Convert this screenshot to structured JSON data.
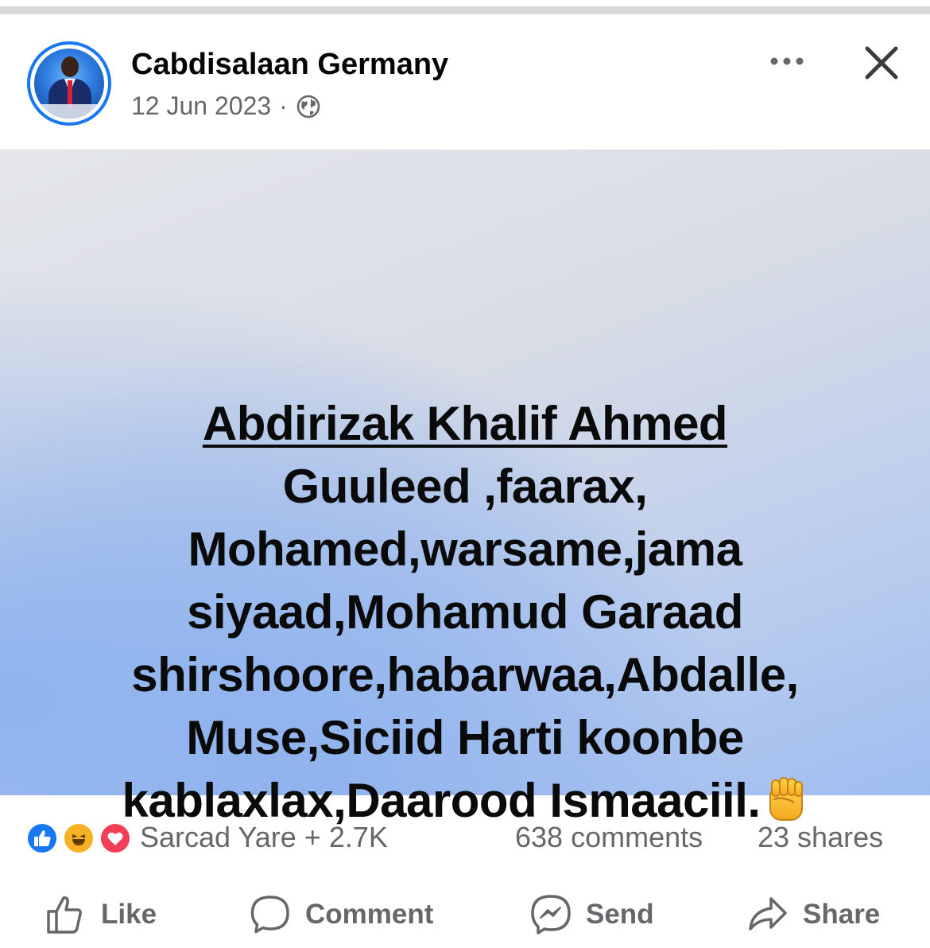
{
  "post": {
    "author": "Cabdisalaan Germany",
    "date": "12 Jun 2023",
    "separator": "·",
    "audience_icon": "globe-icon",
    "more_icon": "more-options-icon",
    "close_icon": "close-icon"
  },
  "image_text": {
    "headline": "Abdirizak Khalif Ahmed",
    "lines": [
      "Guuleed ,faarax,",
      "Mohamed,warsame,jama",
      "siyaad,Mohamud Garaad",
      "shirshoore,habarwaa,Abdalle,",
      "Muse,Siciid Harti koonbe",
      "kablaxlax,Daarood Ismaaciil."
    ],
    "trailing_emoji": "fist-emoji-icon"
  },
  "engagement": {
    "reaction_icons": [
      "like-reaction-icon",
      "haha-reaction-icon",
      "love-reaction-icon"
    ],
    "reactors": "Sarcad Yare + 2.7K",
    "comments": "638 comments",
    "shares": "23 shares"
  },
  "actions": {
    "like": "Like",
    "comment": "Comment",
    "send": "Send",
    "share": "Share"
  },
  "colors": {
    "accent": "#1877f2",
    "secondary_text": "#65676b",
    "love": "#f33e58",
    "haha": "#f7b125"
  }
}
